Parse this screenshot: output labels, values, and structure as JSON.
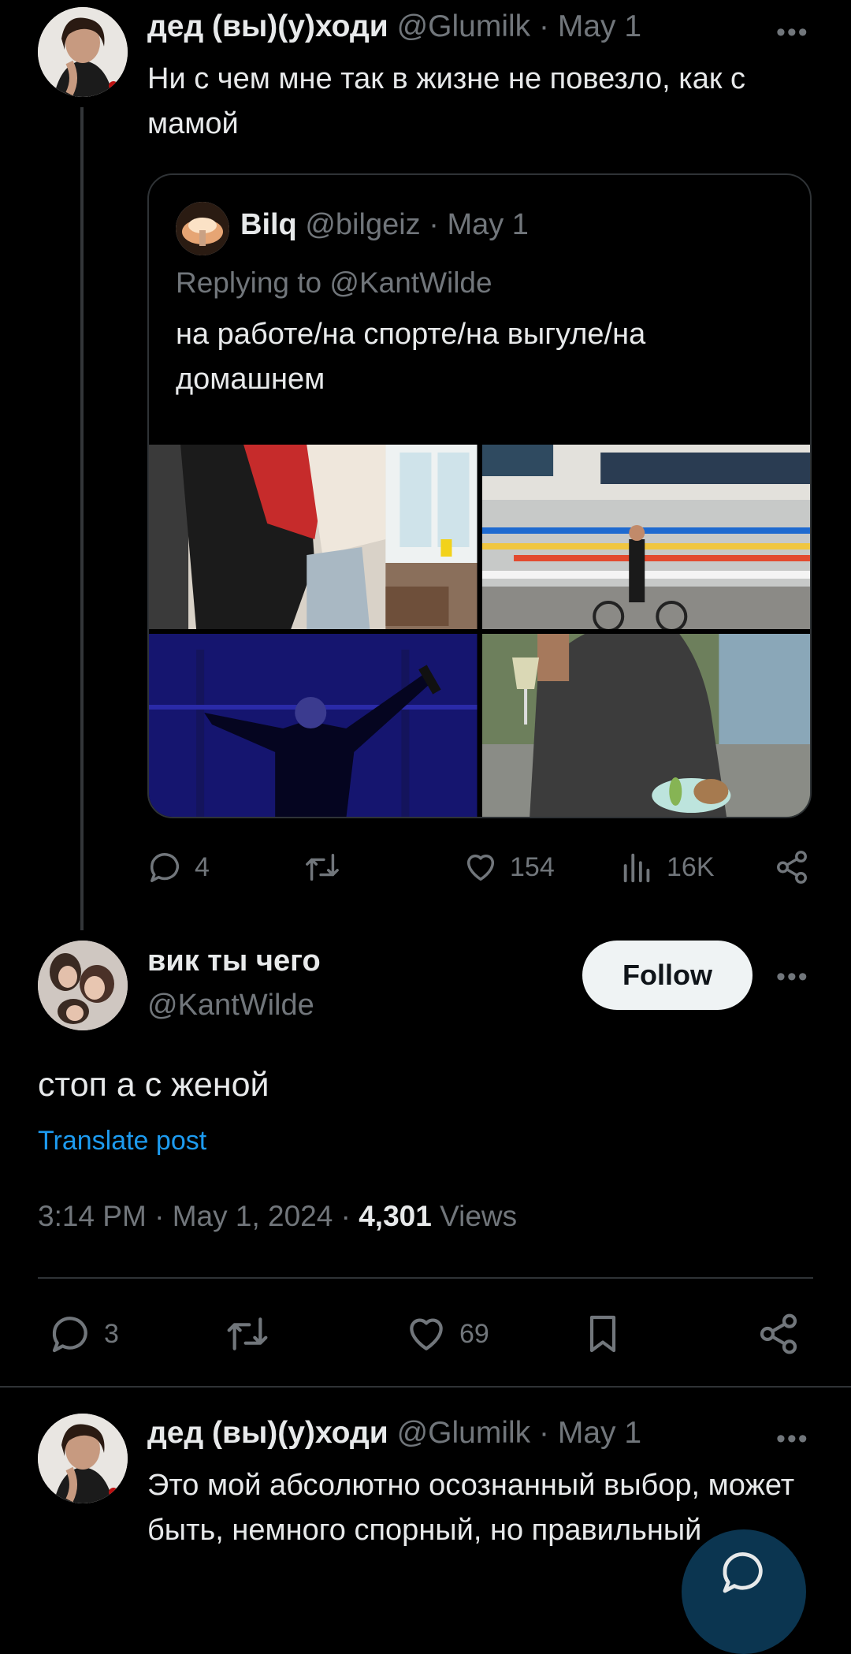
{
  "post1": {
    "author_name": "дед (вы)(у)ходи",
    "handle": "@Glumilk",
    "date": "May 1",
    "text": "Ни с чем мне так в жизне не повезло, как с мамой",
    "quote": {
      "author_name": "Bilq",
      "handle": "@bilgeiz",
      "date": "May 1",
      "replying_to_prefix": "Replying to ",
      "replying_to_handle": "@KantWilde",
      "text": "на работе/на спорте/на выгуле/на домашнем"
    },
    "stats": {
      "replies": "4",
      "retweets": "",
      "likes": "154",
      "views": "16K"
    }
  },
  "main_post": {
    "author_name": "вик ты чего",
    "handle": "@KantWilde",
    "follow_label": "Follow",
    "text": "стоп а с женой",
    "translate_label": "Translate post",
    "time": "3:14 PM",
    "date": "May 1, 2024",
    "views_count": "4,301",
    "views_label": "Views",
    "stats": {
      "replies": "3",
      "likes": "69"
    }
  },
  "post3": {
    "author_name": "дед (вы)(у)ходи",
    "handle": "@Glumilk",
    "date": "May 1",
    "text": "Это мой абсолютно осознанный выбор, может быть, немного спорный, но правильный"
  },
  "separator": "·",
  "more_glyph": "•••",
  "colors": {
    "background": "#000000",
    "text": "#e7e9ea",
    "muted": "#71767b",
    "link": "#1d9bf0",
    "border": "#2f3336",
    "follow_bg": "#eff3f4"
  },
  "icons": [
    "reply-icon",
    "retweet-icon",
    "like-icon",
    "views-icon",
    "share-icon",
    "bookmark-icon",
    "more-icon",
    "compose-icon"
  ]
}
